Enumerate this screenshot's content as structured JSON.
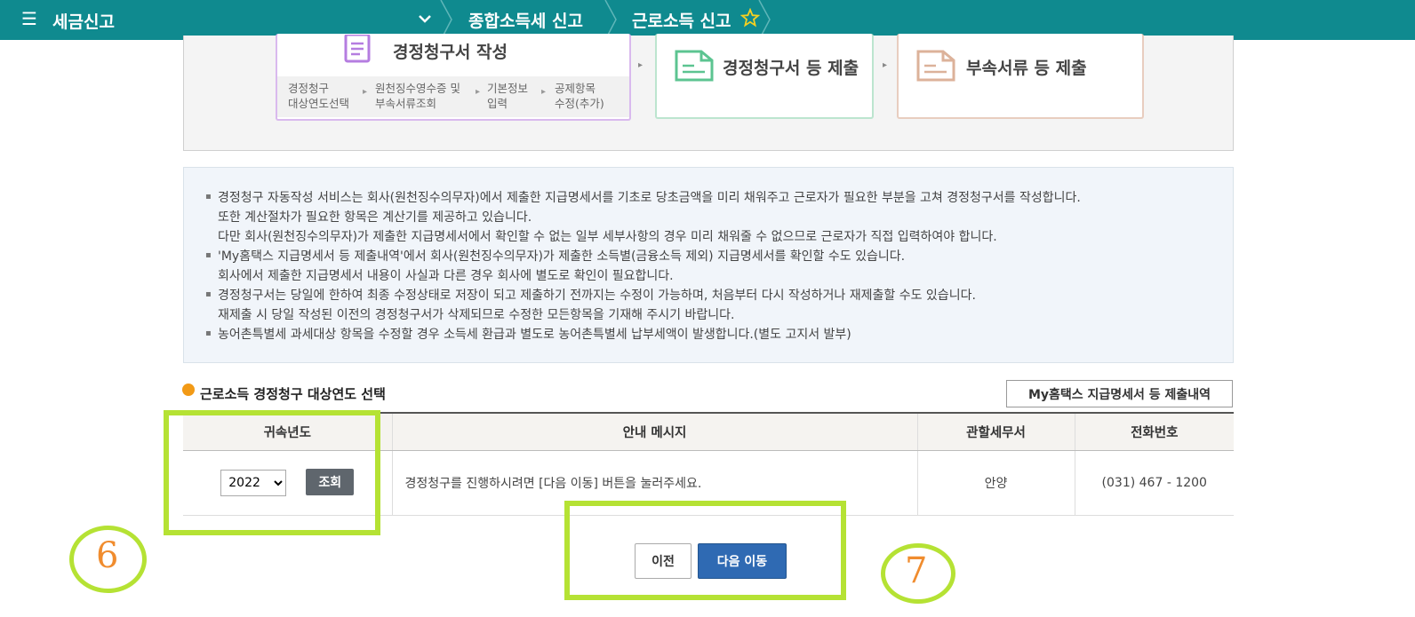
{
  "topbar": {
    "menu_icon": "hamburger-icon",
    "brand": "세금신고",
    "crumb1": "종합소득세 신고",
    "crumb2": "근로소득 신고",
    "color": "#0f8a8f"
  },
  "steps": {
    "step1_title": "경정청구서 작성",
    "step1_subs": [
      "경정청구\n대상연도선택",
      "원천징수영수증 및\n부속서류조회",
      "기본정보\n입력",
      "공제항목\n수정(추가)"
    ],
    "step2_title": "경정청구서 등 제출",
    "step3_title": "부속서류 등 제출"
  },
  "notice": {
    "lines": [
      "경정청구 자동작성 서비스는 회사(원천징수의무자)에서 제출한 지급명세서를 기초로 당초금액을 미리 채워주고 근로자가 필요한 부분을 고쳐 경정청구서를 작성합니다.",
      "또한 계산절차가 필요한 항목은 계산기를 제공하고 있습니다.",
      "다만 회사(원천징수의무자)가 제출한 지급명세서에서 확인할 수 없는 일부 세부사항의 경우 미리 채워줄 수 없으므로 근로자가 직접 입력하여야 합니다.",
      "'My홈택스 지급명세서 등 제출내역'에서 회사(원천징수의무자)가 제출한 소득별(금융소득 제외) 지급명세서를 확인할 수도 있습니다.",
      "회사에서 제출한 지급명세서 내용이 사실과 다른 경우 회사에 별도로 확인이 필요합니다.",
      "경정청구서는 당일에 한하여 최종 수정상태로 저장이 되고 제출하기 전까지는 수정이 가능하며, 처음부터 다시 작성하거나 재제출할 수도 있습니다.",
      "재제출 시 당일 작성된 이전의 경정청구서가 삭제되므로 수정한 모든항목을 기재해 주시기 바랍니다.",
      "농어촌특별세 과세대상 항목을 수정할 경우 소득세 환급과 별도로 농어촌특별세 납부세액이 발생합니다.(별도 고지서 발부)"
    ]
  },
  "section": {
    "title": "근로소득 경정청구 대상연도 선택",
    "history_button": "My홈택스 지급명세서 등 제출내역"
  },
  "table": {
    "headers": [
      "귀속년도",
      "안내 메시지",
      "관할세무서",
      "전화번호"
    ],
    "row": {
      "year": "2022",
      "query_button": "조회",
      "message": "경정청구를 진행하시려면 [다음 이동] 버튼을 눌러주세요.",
      "office": "안양",
      "phone": "(031) 467 - 1200"
    }
  },
  "buttons": {
    "prev": "이전",
    "next": "다음 이동"
  },
  "annotations": {
    "num6": "6",
    "num7": "7",
    "color": "#b5e234"
  }
}
